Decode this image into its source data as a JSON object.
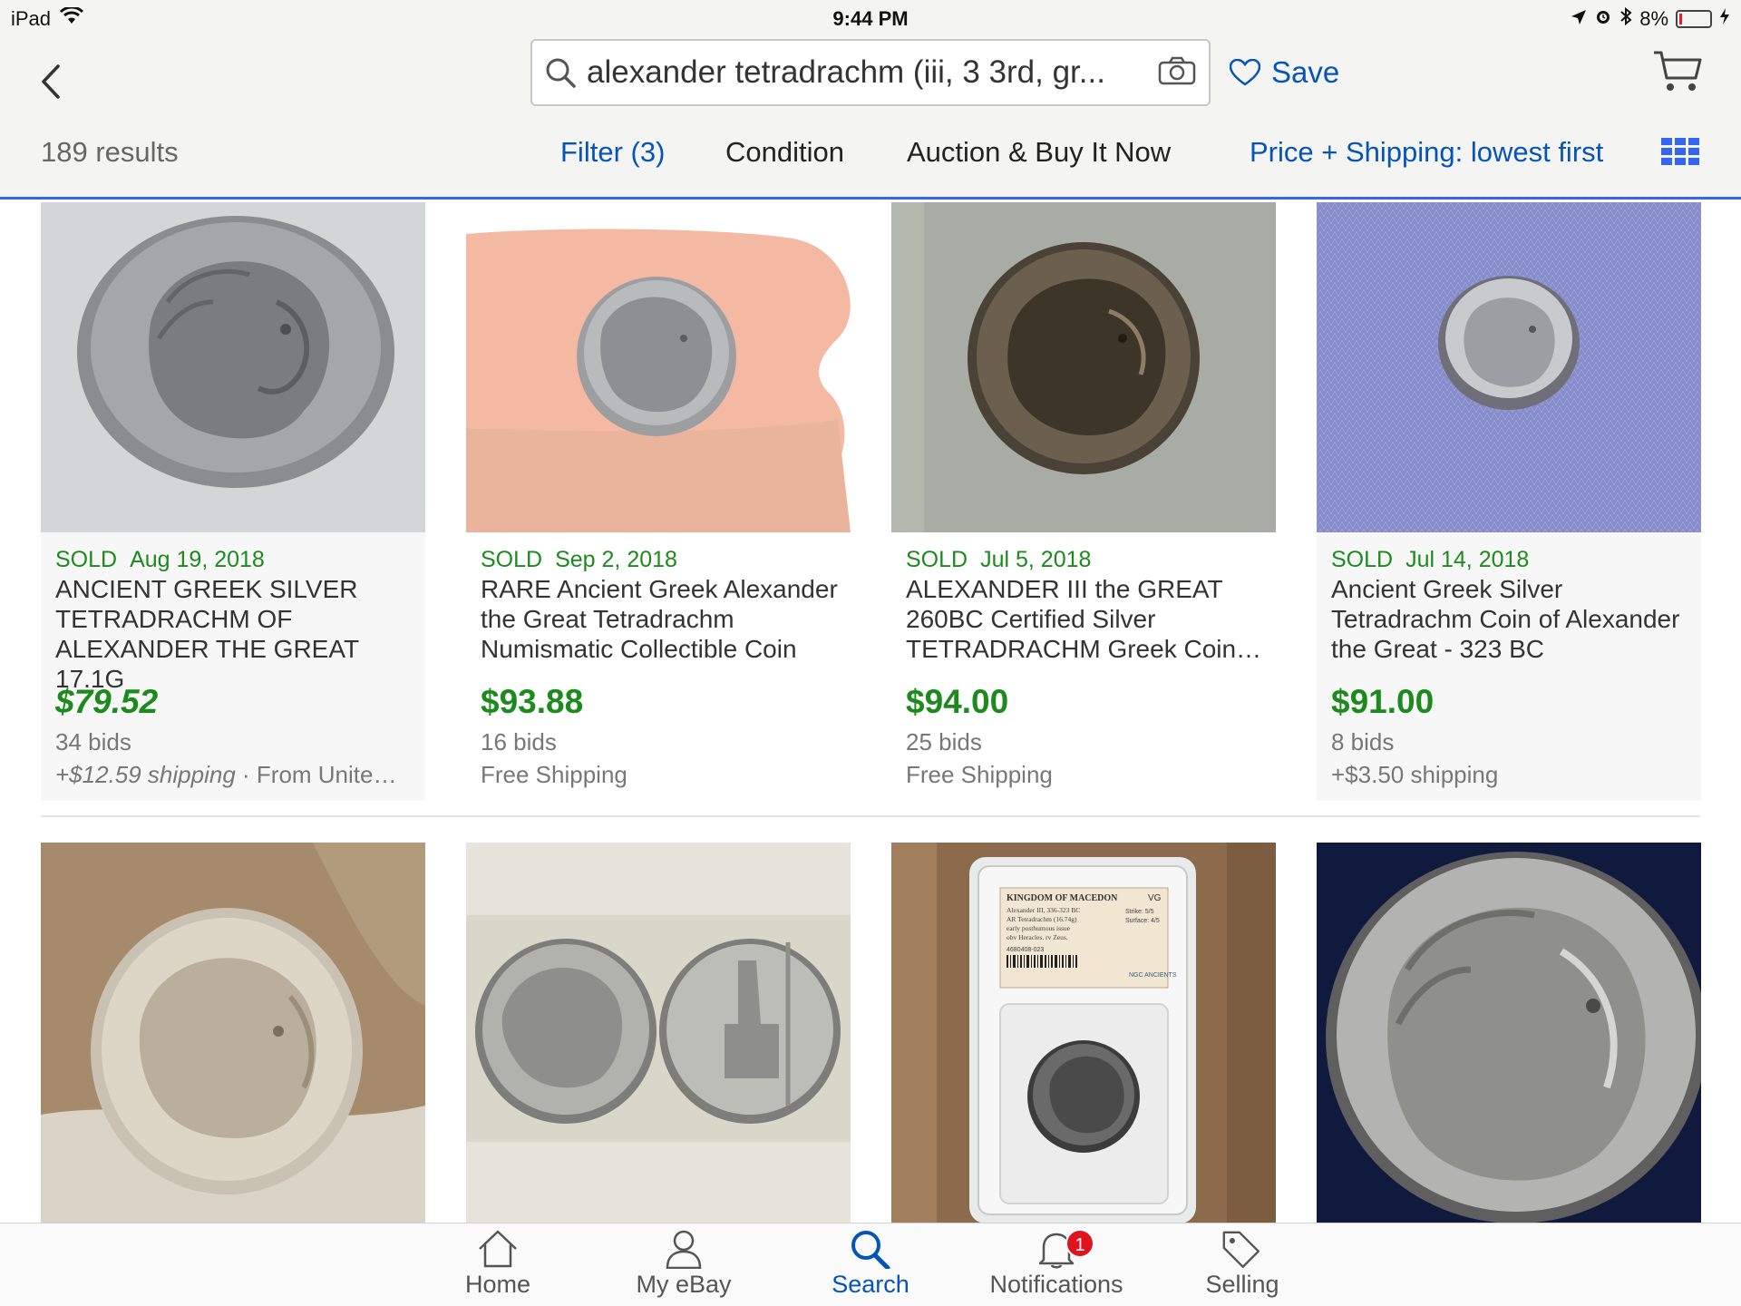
{
  "status_bar": {
    "device": "iPad",
    "time": "9:44 PM",
    "battery": "8%",
    "battery_level": 0.08,
    "icons": [
      "wifi-icon",
      "location-arrow-icon",
      "alarm-icon",
      "bluetooth-icon",
      "battery-icon",
      "charging-icon"
    ]
  },
  "header": {
    "search_query": "alexander tetradrachm (iii, 3 3rd, gr...",
    "save_label": "Save",
    "results_count": "189 results",
    "filters": {
      "filter": "Filter (3)",
      "condition": "Condition",
      "format": "Auction & Buy It Now",
      "sort": "Price + Shipping: lowest first"
    },
    "accent_color": "#3665f3",
    "link_color": "#0654ba"
  },
  "listings": [
    {
      "sold": "SOLD",
      "date": "Aug 19, 2018",
      "title": "ANCIENT GREEK SILVER TETRADRACHM OF ALEXANDER THE GREAT 17.1G",
      "price": "$79.52",
      "bids": "34 bids",
      "shipping": "+$12.59 shipping",
      "origin": " · From Unite…",
      "price_italic": true
    },
    {
      "sold": "SOLD",
      "date": "Sep 2, 2018",
      "title": "RARE Ancient Greek Alexander the Great Tetradrachm Numismatic Collectible Coin",
      "price": "$93.88",
      "bids": "16 bids",
      "shipping": "Free Shipping"
    },
    {
      "sold": "SOLD",
      "date": "Jul 5, 2018",
      "title": "ALEXANDER III the GREAT 260BC Certified Silver TETRADRACHM Greek Coin…",
      "price": "$94.00",
      "bids": "25 bids",
      "shipping": "Free Shipping"
    },
    {
      "sold": "SOLD",
      "date": "Jul 14, 2018",
      "title": "Ancient Greek Silver Tetradrachm Coin of Alexander the Great - 323 BC",
      "price": "$91.00",
      "bids": "8 bids",
      "shipping": "+$3.50 shipping"
    }
  ],
  "slab_label": {
    "line1": "KINGDOM OF MACEDON",
    "grade": "VG",
    "line2": "Alexander III, 336-323 BC",
    "line3": "AR Tetradrachm (16.74g)",
    "line4": "early posthumous issue",
    "line5": "obv Heracles. rv Zeus.",
    "strike": "Strike: 5/5",
    "surface": "Surface: 4/5",
    "cert": "4680408-023",
    "brand": "NGC ANCIENTS"
  },
  "tabbar": {
    "tabs": [
      {
        "label": "Home",
        "icon": "home-icon"
      },
      {
        "label": "My eBay",
        "icon": "person-icon"
      },
      {
        "label": "Search",
        "icon": "search-icon"
      },
      {
        "label": "Notifications",
        "icon": "bell-icon"
      },
      {
        "label": "Selling",
        "icon": "tag-icon"
      }
    ],
    "active": "Search",
    "notification_count": "1"
  }
}
